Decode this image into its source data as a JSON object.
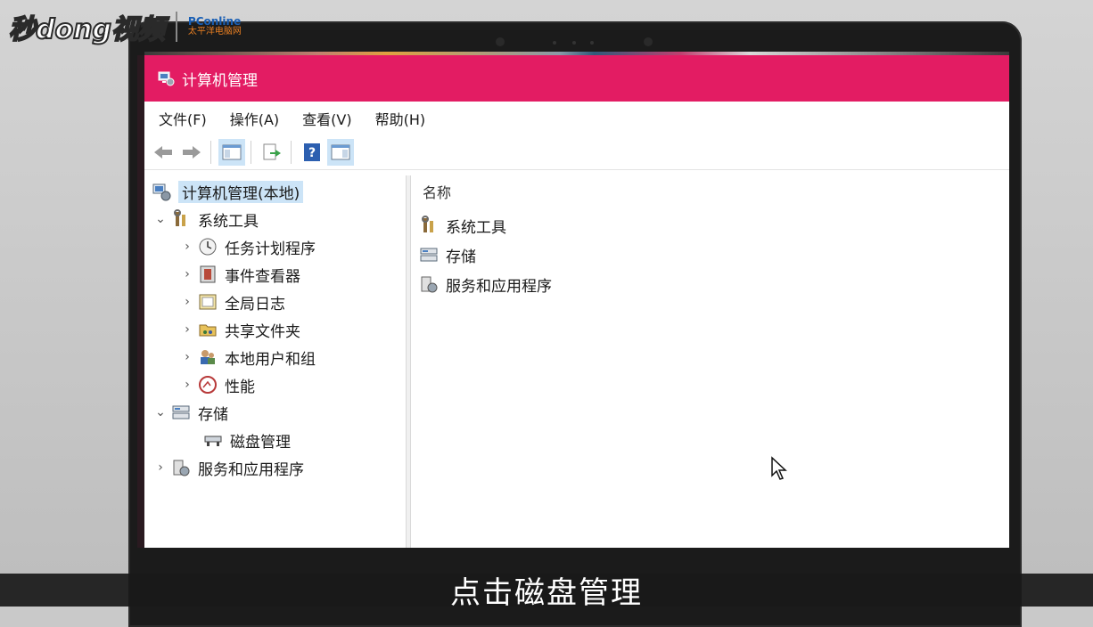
{
  "watermark": {
    "brand": "秒dong视频",
    "partner": "PConline",
    "partner_sub": "太平洋电脑网"
  },
  "window": {
    "title": "计算机管理"
  },
  "menu": [
    "文件(F)",
    "操作(A)",
    "查看(V)",
    "帮助(H)"
  ],
  "tree": {
    "root": "计算机管理(本地)",
    "system_tools": "系统工具",
    "task_scheduler": "任务计划程序",
    "event_viewer": "事件查看器",
    "global_log": "全局日志",
    "shared_folders": "共享文件夹",
    "local_users": "本地用户和组",
    "performance": "性能",
    "storage": "存储",
    "disk_management": "磁盘管理",
    "services_apps": "服务和应用程序"
  },
  "right_pane": {
    "column_header": "名称",
    "items": [
      "系统工具",
      "存储",
      "服务和应用程序"
    ]
  },
  "caption": "点击磁盘管理",
  "colors": {
    "titlebar": "#e31c63",
    "selection": "#cce4f7"
  }
}
